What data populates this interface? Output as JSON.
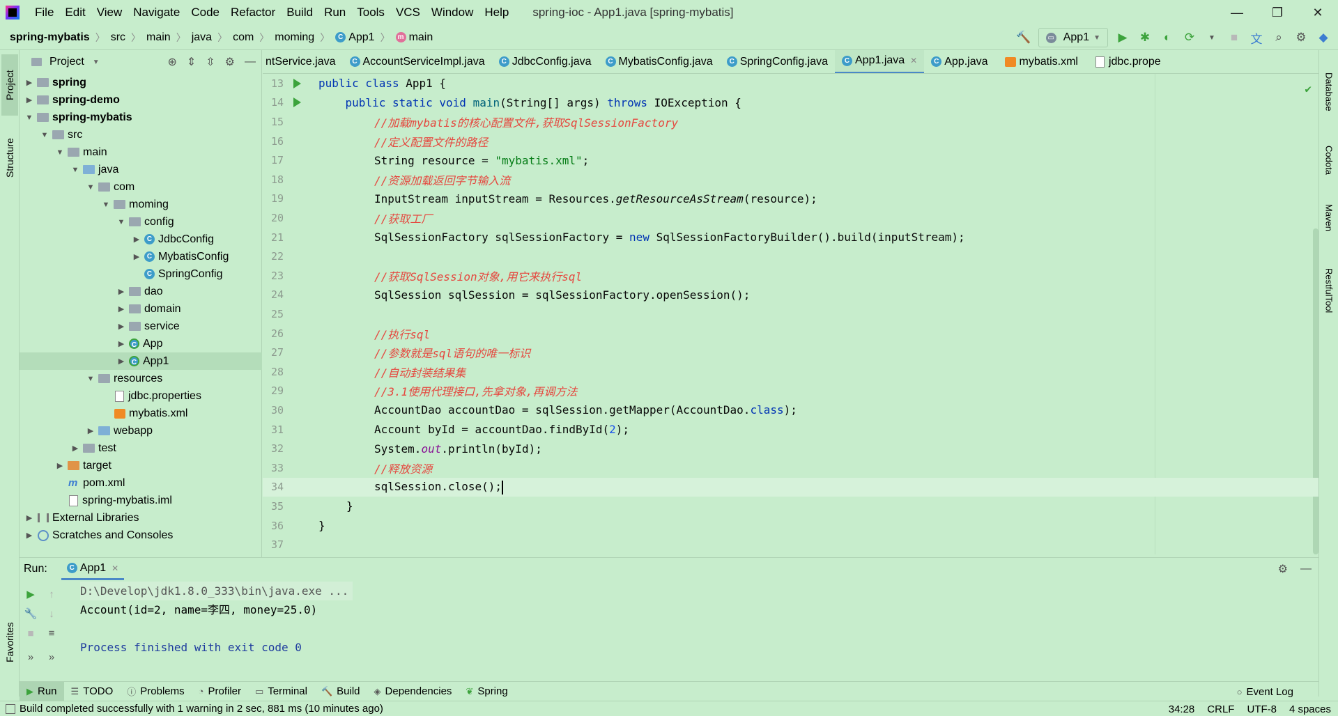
{
  "menubar": {
    "items": [
      "File",
      "Edit",
      "View",
      "Navigate",
      "Code",
      "Refactor",
      "Build",
      "Run",
      "Tools",
      "VCS",
      "Window",
      "Help"
    ],
    "title": "spring-ioc - App1.java [spring-mybatis]",
    "minimize": "—",
    "restore": "❐",
    "close": "✕"
  },
  "navbar": {
    "project": "spring-mybatis",
    "crumbs": [
      "src",
      "main",
      "java",
      "com",
      "moming",
      "App1",
      "main"
    ],
    "run_config": "App1"
  },
  "left_strip": {
    "project_tab": "Project",
    "structure_tab": "Structure",
    "favorites_tab": "Favorites"
  },
  "right_strip": {
    "database": "Database",
    "codota": "Codota",
    "maven": "Maven",
    "restful": "RestfulTool"
  },
  "project_panel": {
    "title": "Project",
    "tree": [
      {
        "label": "spring"
      },
      {
        "label": "spring-demo"
      },
      {
        "label": "spring-mybatis"
      },
      {
        "label": "src"
      },
      {
        "label": "main"
      },
      {
        "label": "java"
      },
      {
        "label": "com"
      },
      {
        "label": "moming"
      },
      {
        "label": "config"
      },
      {
        "label": "JdbcConfig"
      },
      {
        "label": "MybatisConfig"
      },
      {
        "label": "SpringConfig"
      },
      {
        "label": "dao"
      },
      {
        "label": "domain"
      },
      {
        "label": "service"
      },
      {
        "label": "App"
      },
      {
        "label": "App1"
      },
      {
        "label": "resources"
      },
      {
        "label": "jdbc.properties"
      },
      {
        "label": "mybatis.xml"
      },
      {
        "label": "webapp"
      },
      {
        "label": "test"
      },
      {
        "label": "target"
      },
      {
        "label": "pom.xml"
      },
      {
        "label": "spring-mybatis.iml"
      },
      {
        "label": "External Libraries"
      },
      {
        "label": "Scratches and Consoles"
      }
    ]
  },
  "editor_tabs": [
    {
      "label": "ntService.java"
    },
    {
      "label": "AccountServiceImpl.java"
    },
    {
      "label": "JdbcConfig.java"
    },
    {
      "label": "MybatisConfig.java"
    },
    {
      "label": "SpringConfig.java"
    },
    {
      "label": "App1.java"
    },
    {
      "label": "App.java"
    },
    {
      "label": "mybatis.xml"
    },
    {
      "label": "jdbc.prope"
    }
  ],
  "editor": {
    "line_numbers": [
      "13",
      "14",
      "15",
      "16",
      "17",
      "18",
      "19",
      "20",
      "21",
      "22",
      "23",
      "24",
      "25",
      "26",
      "27",
      "28",
      "29",
      "30",
      "31",
      "32",
      "33",
      "34",
      "35",
      "36",
      "37"
    ],
    "code": {
      "l13_kw": "public class ",
      "l13_rest": "App1 {",
      "l14_indent": "    ",
      "l14_kw1": "public static void ",
      "l14_fn": "main",
      "l14_mid": "(String[] args) ",
      "l14_kw2": "throws ",
      "l14_rest": "IOException {",
      "l15": "//加载mybatis的核心配置文件,获取SqlSessionFactory",
      "l16": "//定义配置文件的路径",
      "l17_a": "String resource = ",
      "l17_str": "\"mybatis.xml\"",
      "l17_b": ";",
      "l18": "//资源加载返回字节输入流",
      "l19_a": "InputStream inputStream = Resources.",
      "l19_it": "getResourceAsStream",
      "l19_b": "(resource);",
      "l20": "//获取工厂",
      "l21_a": "SqlSessionFactory sqlSessionFactory = ",
      "l21_kw": "new ",
      "l21_b": "SqlSessionFactoryBuilder().build(inputStream);",
      "l23": "//获取SqlSession对象,用它来执行sql",
      "l24": "SqlSession sqlSession = sqlSessionFactory.openSession();",
      "l26": "//执行sql",
      "l27": "//参数就是sql语句的唯一标识",
      "l28": "//自动封装结果集",
      "l29": "//3.1使用代理接口,先拿对象,再调方法",
      "l30_a": "AccountDao accountDao = sqlSession.getMapper(AccountDao.",
      "l30_kw": "class",
      "l30_b": ");",
      "l31_a": "Account byId = accountDao.findById(",
      "l31_num": "2",
      "l31_b": ");",
      "l32_a": "System.",
      "l32_fld": "out",
      "l32_b": ".println(byId);",
      "l33": "//释放资源",
      "l34": "sqlSession.close();",
      "l35": "}",
      "l36": "}"
    }
  },
  "run_panel": {
    "label": "Run:",
    "tab": "App1",
    "console": [
      "D:\\Develop\\jdk1.8.0_333\\bin\\java.exe ...",
      "Account(id=2, name=李四, money=25.0)",
      "",
      "Process finished with exit code 0"
    ]
  },
  "bottom_bar": {
    "items": [
      "Run",
      "TODO",
      "Problems",
      "Profiler",
      "Terminal",
      "Build",
      "Dependencies",
      "Spring"
    ],
    "event_log": "Event Log"
  },
  "statusbar": {
    "message": "Build completed successfully with 1 warning in 2 sec, 881 ms (10 minutes ago)",
    "position": "34:28",
    "line_sep": "CRLF",
    "encoding": "UTF-8",
    "indent": "4 spaces"
  },
  "colors": {
    "background": "#C7EDCC",
    "keyword": "#0033B3",
    "comment": "#E5483F",
    "string": "#067D17",
    "run_green": "#3CA33C",
    "active_tab": "#4A88C7"
  }
}
